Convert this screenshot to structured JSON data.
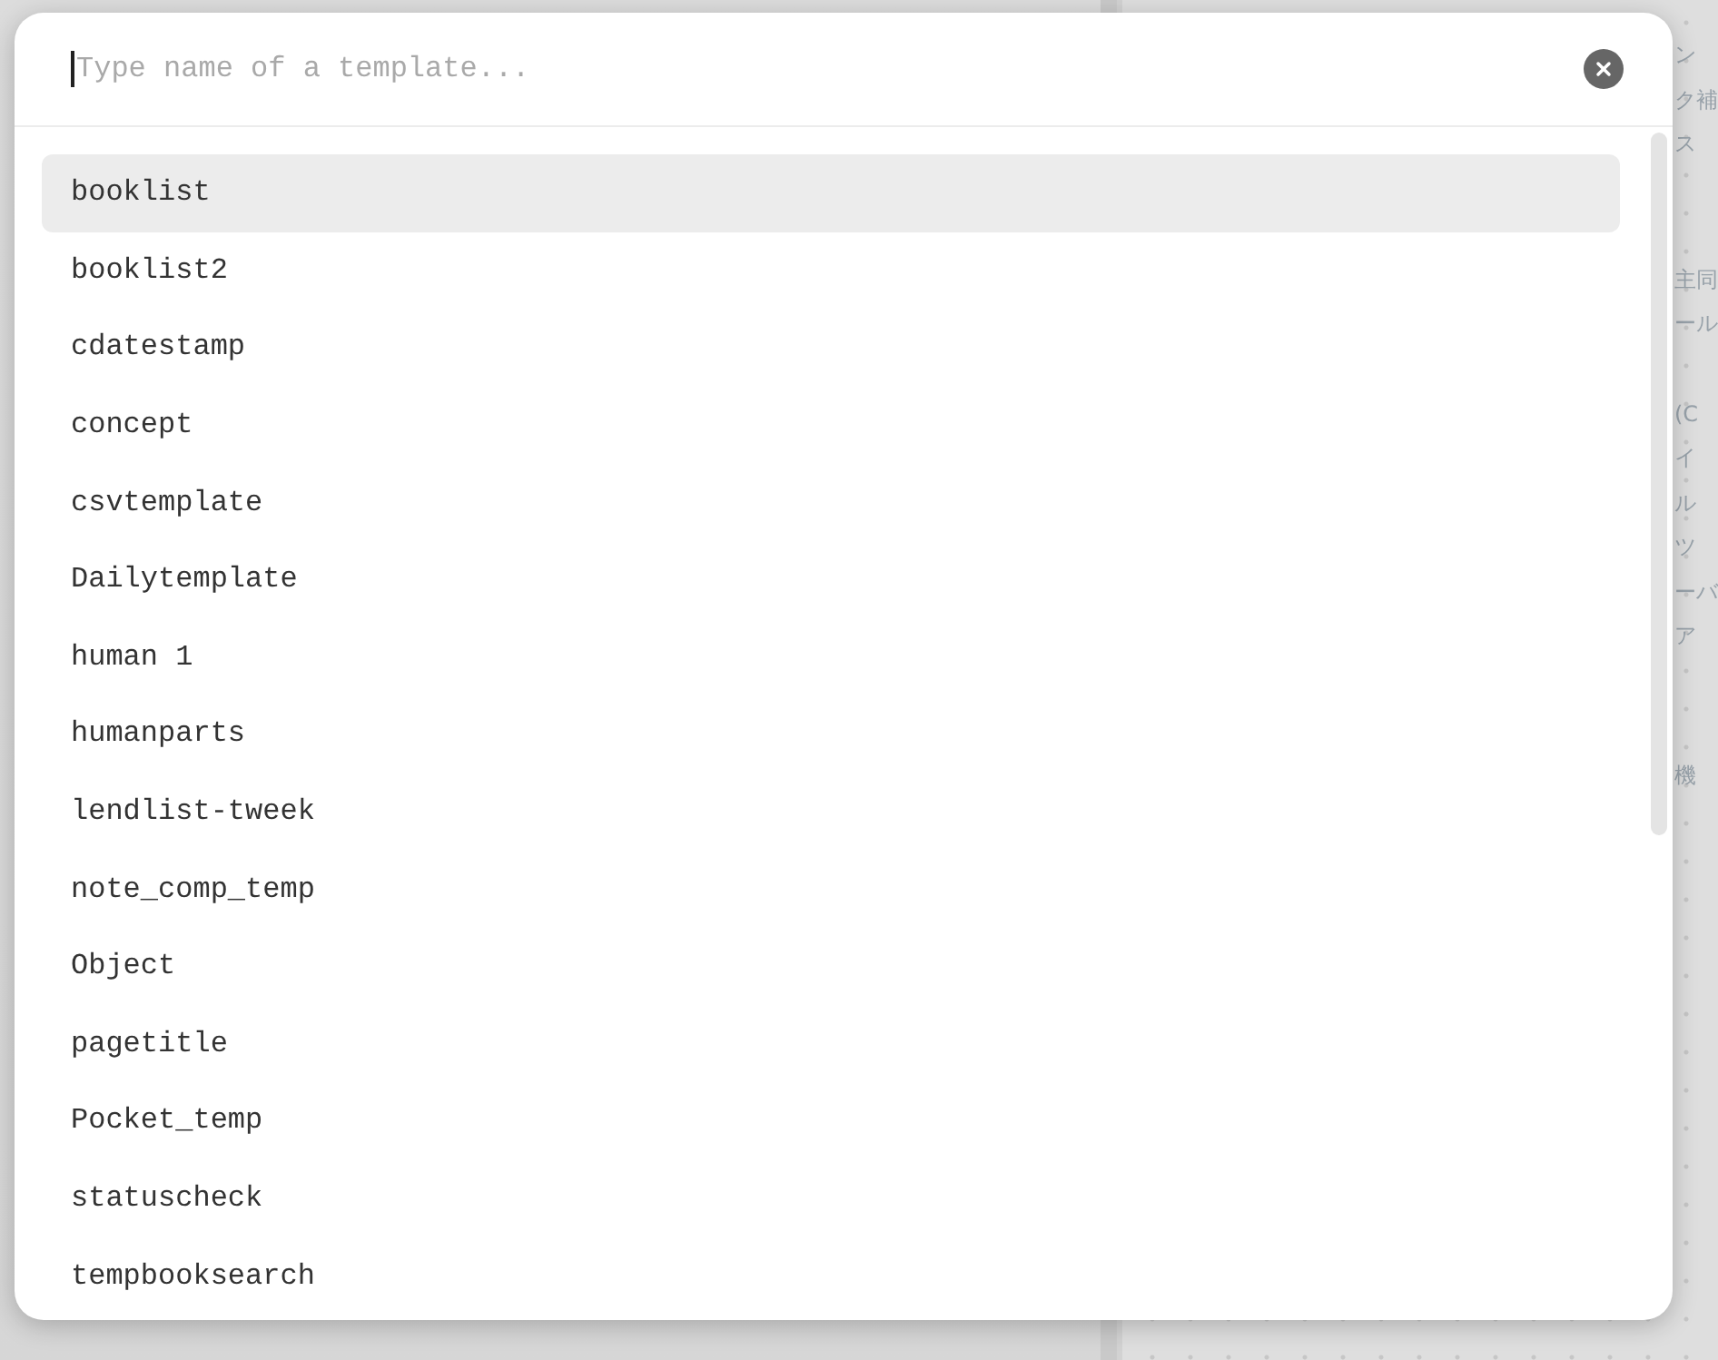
{
  "search": {
    "placeholder": "Type name of a template...",
    "focused": true
  },
  "templates": [
    {
      "name": "booklist",
      "selected": true
    },
    {
      "name": "booklist2",
      "selected": false
    },
    {
      "name": "cdatestamp",
      "selected": false
    },
    {
      "name": "concept",
      "selected": false
    },
    {
      "name": "csvtemplate",
      "selected": false
    },
    {
      "name": "Dailytemplate",
      "selected": false
    },
    {
      "name": "human 1",
      "selected": false
    },
    {
      "name": "humanparts",
      "selected": false
    },
    {
      "name": "lendlist-tweek",
      "selected": false
    },
    {
      "name": "note_comp_temp",
      "selected": false
    },
    {
      "name": "Object",
      "selected": false
    },
    {
      "name": "pagetitle",
      "selected": false
    },
    {
      "name": "Pocket_temp",
      "selected": false
    },
    {
      "name": "statuscheck",
      "selected": false
    },
    {
      "name": "tempbooksearch",
      "selected": false
    }
  ],
  "background": {
    "fragment_groups": [
      {
        "lines": [
          "ン",
          "ク補",
          "ス"
        ]
      },
      {
        "lines": [
          "主同",
          "ール"
        ]
      },
      {
        "lines": [
          "(C",
          "イ",
          "ル",
          "ツ",
          "ーバ",
          "ア"
        ]
      },
      {
        "lines": [
          "機"
        ]
      }
    ]
  }
}
